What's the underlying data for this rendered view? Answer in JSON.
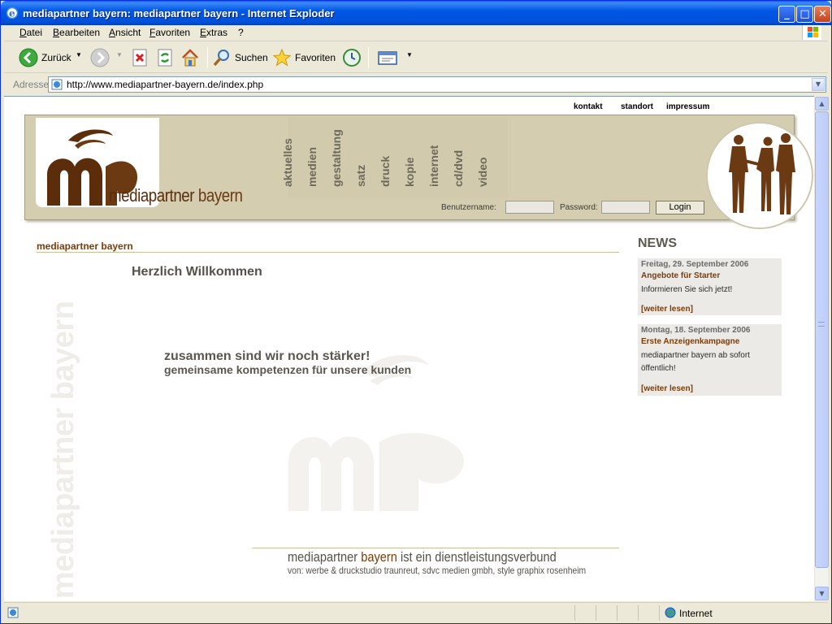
{
  "window": {
    "title": "mediapartner bayern: mediapartner bayern - Internet Exploder"
  },
  "menu": [
    "Datei",
    "Bearbeiten",
    "Ansicht",
    "Favoriten",
    "Extras",
    "?"
  ],
  "toolbar": {
    "back_label": "Zurück",
    "search_label": "Suchen",
    "favorites_label": "Favoriten"
  },
  "address": {
    "label": "Adresse",
    "url": "http://www.mediapartner-bayern.de/index.php"
  },
  "page": {
    "top_links": [
      "kontakt",
      "standort",
      "impressum"
    ],
    "brand_part1": "mediapartner",
    "brand_part2": "bayern",
    "nav": [
      "aktuelles",
      "medien",
      "gestaltung",
      "satz",
      "druck",
      "kopie",
      "internet",
      "cd/dvd",
      "video"
    ],
    "login": {
      "username_label": "Benutzername:",
      "password_label": "Password:",
      "button": "Login"
    },
    "section_title": "mediapartner bayern",
    "welcome": "Herzlich Willkommen",
    "slogan_line1": "zusammen sind wir noch stärker!",
    "slogan_line2": "gemeinsame kompetenzen für unsere kunden",
    "watermark": "mediapartner bayern",
    "footer_part1": "mediapartner",
    "footer_part2": "bayern",
    "footer_part3": "ist ein dienstleistungsverbund",
    "footer_line2": "von: werbe & druckstudio traunreut, sdvc medien gmbh, style graphix rosenheim"
  },
  "news": {
    "title": "NEWS",
    "items": [
      {
        "date": "Freitag, 29. September 2006",
        "headline": "Angebote für Starter",
        "body": "Informieren Sie sich jetzt!",
        "more": "[weiter lesen]"
      },
      {
        "date": "Montag, 18. September 2006",
        "headline": "Erste Anzeigenkampagne",
        "body": "mediapartner bayern ab sofort öffentlich!",
        "more": "[weiter lesen]"
      }
    ]
  },
  "status": {
    "zone": "Internet"
  },
  "colors": {
    "brand_brown": "#5b2d0b",
    "header_beige": "#d4cdb0",
    "accent_brown": "#7a3d0a"
  }
}
